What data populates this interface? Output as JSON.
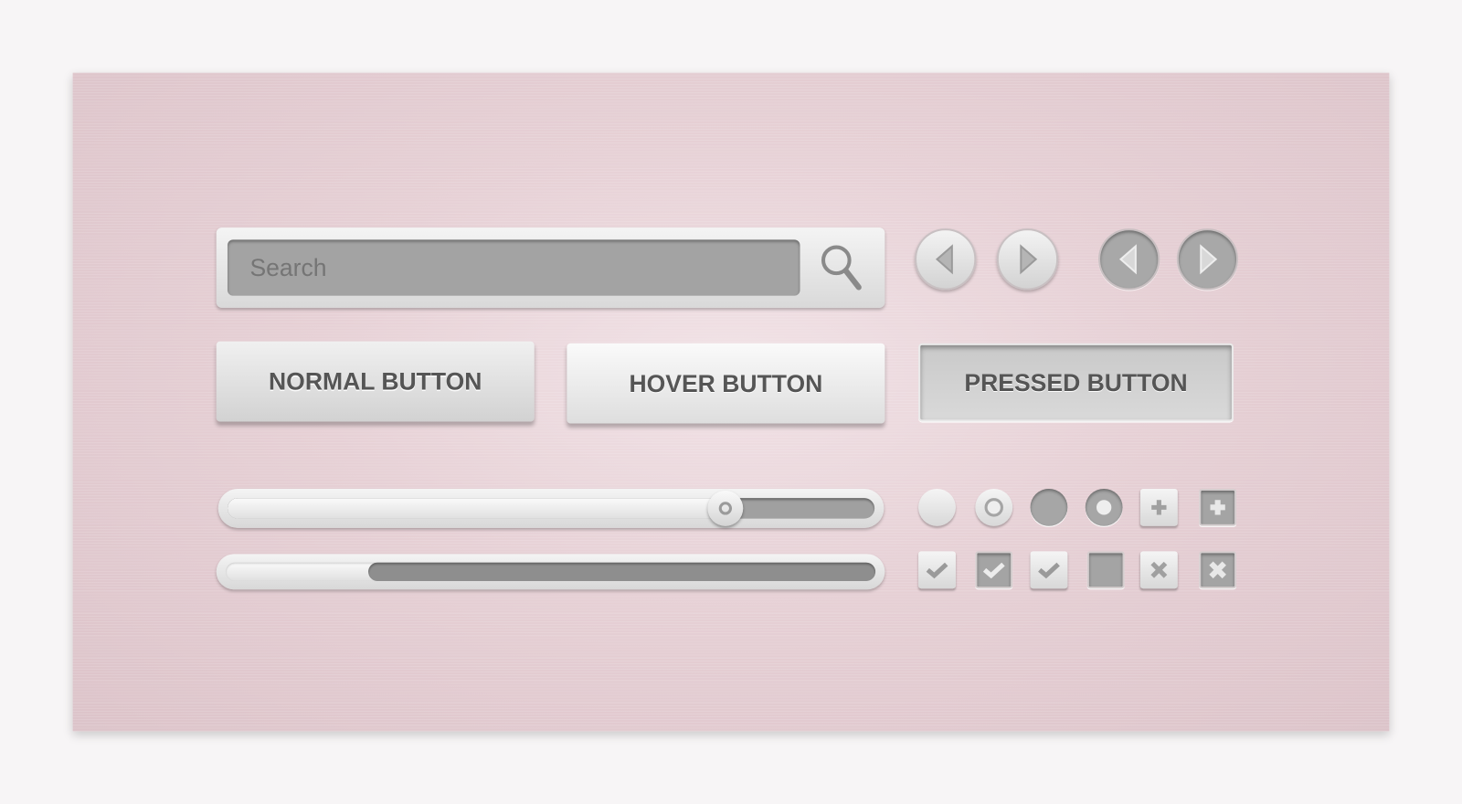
{
  "search": {
    "placeholder": "Search",
    "icon": "search-icon"
  },
  "nav_arrows": [
    {
      "direction": "left",
      "style": "light"
    },
    {
      "direction": "right",
      "style": "light"
    },
    {
      "direction": "left",
      "style": "dark"
    },
    {
      "direction": "right",
      "style": "dark"
    }
  ],
  "buttons": {
    "normal": "NORMAL BUTTON",
    "hover": "HOVER BUTTON",
    "pressed": "PRESSED BUTTON"
  },
  "slider": {
    "value_percent": 77
  },
  "progress": {
    "filled_percent": 78,
    "fill_side": "right"
  },
  "radios": [
    {
      "state": "unchecked",
      "style": "light"
    },
    {
      "state": "checked",
      "style": "light"
    },
    {
      "state": "unchecked",
      "style": "dark"
    },
    {
      "state": "checked",
      "style": "dark"
    }
  ],
  "plus_buttons": [
    {
      "style": "light",
      "icon": "plus-icon"
    },
    {
      "style": "dark",
      "icon": "plus-icon"
    }
  ],
  "checkboxes": [
    {
      "state": "checked",
      "style": "light"
    },
    {
      "state": "checked",
      "style": "dark"
    },
    {
      "state": "checked",
      "style": "light"
    },
    {
      "state": "unchecked",
      "style": "dark"
    }
  ],
  "close_buttons": [
    {
      "style": "light",
      "icon": "x-icon"
    },
    {
      "style": "dark",
      "icon": "x-icon"
    }
  ],
  "colors": {
    "background": "#e6d0d5",
    "control_light": "#e6e6e6",
    "control_dark": "#a4a4a4",
    "text": "#555555"
  }
}
